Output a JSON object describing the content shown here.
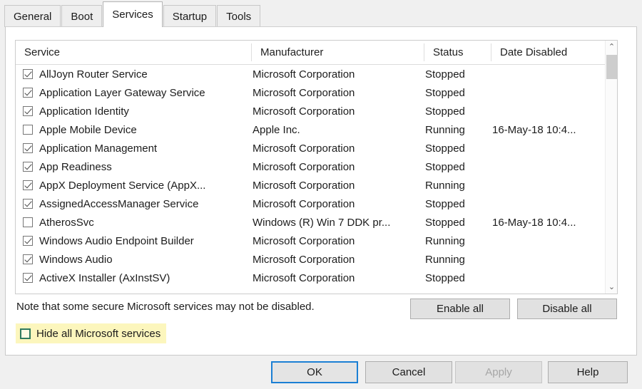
{
  "tabs": [
    {
      "label": "General",
      "active": false
    },
    {
      "label": "Boot",
      "active": false
    },
    {
      "label": "Services",
      "active": true
    },
    {
      "label": "Startup",
      "active": false
    },
    {
      "label": "Tools",
      "active": false
    }
  ],
  "table": {
    "columns": [
      {
        "key": "service",
        "label": "Service"
      },
      {
        "key": "manufacturer",
        "label": "Manufacturer"
      },
      {
        "key": "status",
        "label": "Status"
      },
      {
        "key": "date_disabled",
        "label": "Date Disabled"
      }
    ],
    "rows": [
      {
        "checked": true,
        "service": "AllJoyn Router Service",
        "manufacturer": "Microsoft Corporation",
        "status": "Stopped",
        "date_disabled": ""
      },
      {
        "checked": true,
        "service": "Application Layer Gateway Service",
        "manufacturer": "Microsoft Corporation",
        "status": "Stopped",
        "date_disabled": ""
      },
      {
        "checked": true,
        "service": "Application Identity",
        "manufacturer": "Microsoft Corporation",
        "status": "Stopped",
        "date_disabled": ""
      },
      {
        "checked": false,
        "service": "Apple Mobile Device",
        "manufacturer": "Apple Inc.",
        "status": "Running",
        "date_disabled": "16-May-18 10:4..."
      },
      {
        "checked": true,
        "service": "Application Management",
        "manufacturer": "Microsoft Corporation",
        "status": "Stopped",
        "date_disabled": ""
      },
      {
        "checked": true,
        "service": "App Readiness",
        "manufacturer": "Microsoft Corporation",
        "status": "Stopped",
        "date_disabled": ""
      },
      {
        "checked": true,
        "service": "AppX Deployment Service (AppX...",
        "manufacturer": "Microsoft Corporation",
        "status": "Running",
        "date_disabled": ""
      },
      {
        "checked": true,
        "service": "AssignedAccessManager Service",
        "manufacturer": "Microsoft Corporation",
        "status": "Stopped",
        "date_disabled": ""
      },
      {
        "checked": false,
        "service": "AtherosSvc",
        "manufacturer": "Windows (R) Win 7 DDK pr...",
        "status": "Stopped",
        "date_disabled": "16-May-18 10:4..."
      },
      {
        "checked": true,
        "service": "Windows Audio Endpoint Builder",
        "manufacturer": "Microsoft Corporation",
        "status": "Running",
        "date_disabled": ""
      },
      {
        "checked": true,
        "service": "Windows Audio",
        "manufacturer": "Microsoft Corporation",
        "status": "Running",
        "date_disabled": ""
      },
      {
        "checked": true,
        "service": "ActiveX Installer (AxInstSV)",
        "manufacturer": "Microsoft Corporation",
        "status": "Stopped",
        "date_disabled": ""
      }
    ]
  },
  "scrollbar": {
    "up_arrow": "⌃",
    "down_arrow": "⌄"
  },
  "note": "Note that some secure Microsoft services may not be disabled.",
  "actions": {
    "enable_all": "Enable all",
    "disable_all": "Disable all"
  },
  "hide_all": {
    "label": "Hide all Microsoft services",
    "checked": false,
    "highlight_color": "#fcf6bd",
    "checkbox_border_color": "#2f7a5e"
  },
  "footer": {
    "ok": "OK",
    "cancel": "Cancel",
    "apply": "Apply",
    "help": "Help",
    "apply_disabled": true,
    "default_button_outline": "#1b7fd4"
  }
}
